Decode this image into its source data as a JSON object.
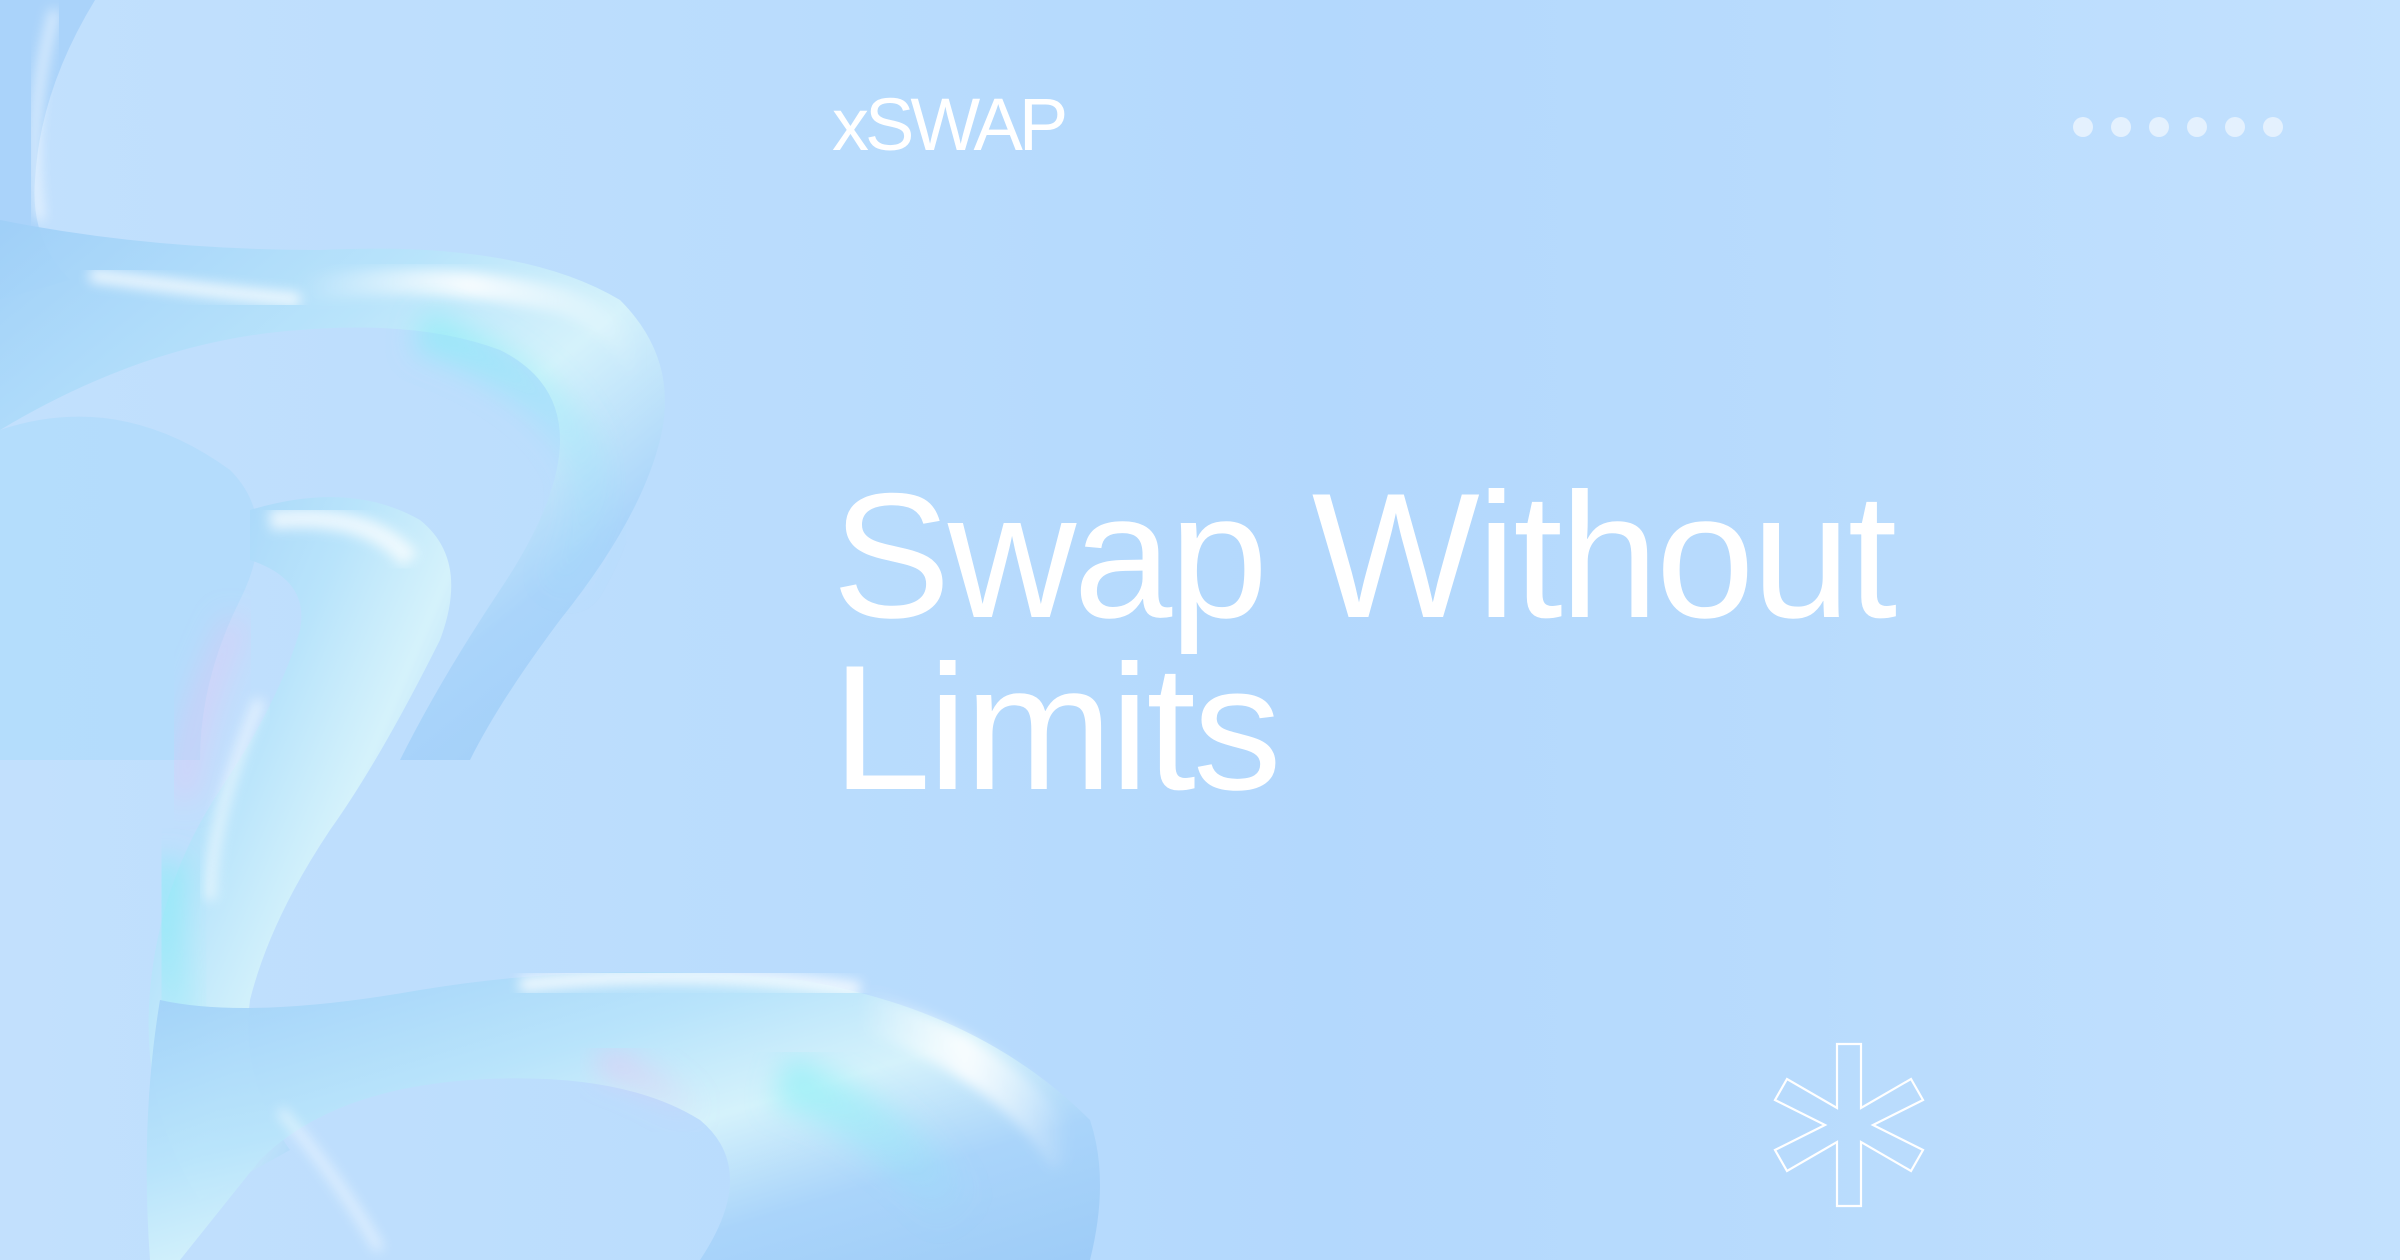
{
  "brand": {
    "logo_text": "xSWAP"
  },
  "hero": {
    "headline_line1": "Swap Without",
    "headline_line2": "Limits"
  },
  "decor": {
    "dots_count": 6,
    "background_color": "#b9dcfd",
    "text_color": "#ffffff",
    "glass_art": "iridescent-glass-ribbon",
    "corner_mark": "asterisk-icon"
  }
}
